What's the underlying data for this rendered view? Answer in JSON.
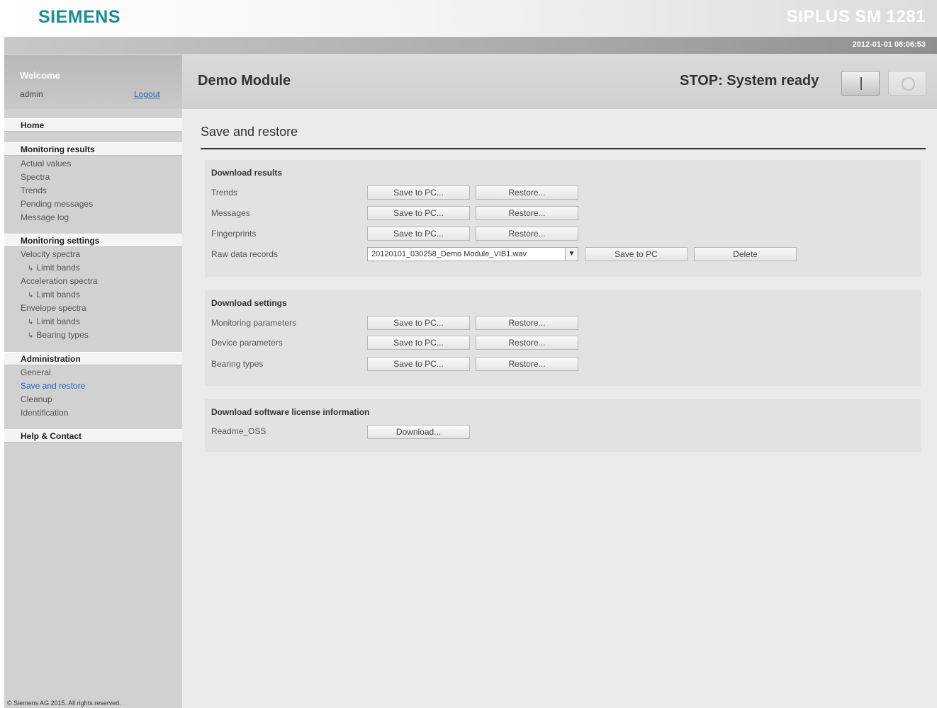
{
  "header": {
    "brand": "SIEMENS",
    "product": "SIPLUS SM 1281",
    "datetime": "2012-01-01 08:06:53"
  },
  "sidebar": {
    "welcome_title": "Welcome",
    "user": "admin",
    "logout": "Logout",
    "home": "Home",
    "monitoring_results": {
      "title": "Monitoring results",
      "items": [
        "Actual values",
        "Spectra",
        "Trends",
        "Pending messages",
        "Message log"
      ]
    },
    "monitoring_settings": {
      "title": "Monitoring settings",
      "items": [
        "Velocity spectra",
        "Limit bands",
        "Acceleration spectra",
        "Limit bands",
        "Envelope spectra",
        "Limit bands",
        "Bearing types"
      ]
    },
    "administration": {
      "title": "Administration",
      "items": [
        "General",
        "Save and restore",
        "Cleanup",
        "Identification"
      ]
    },
    "help": "Help & Contact",
    "copyright": "© Siemens AG 2015. All rights reserved."
  },
  "main": {
    "module_name": "Demo Module",
    "status": "STOP: System ready",
    "page_title": "Save and restore",
    "download_results": {
      "title": "Download results",
      "rows": [
        "Trends",
        "Messages",
        "Fingerprints",
        "Raw data records"
      ],
      "raw_file": "20120101_030258_Demo Module_VIB1.wav"
    },
    "download_settings": {
      "title": "Download settings",
      "rows": [
        "Monitoring parameters",
        "Device parameters",
        "Bearing types"
      ]
    },
    "download_license": {
      "title": "Download software license information",
      "rows": [
        "Readme_OSS"
      ]
    },
    "buttons": {
      "save_to_pc": "Save to PC...",
      "save_to_pc_plain": "Save to PC",
      "restore": "Restore...",
      "delete": "Delete",
      "download": "Download..."
    }
  },
  "colors": {
    "brand": "#1c8c98",
    "link": "#1e63c4",
    "sidebar_bg": "#d1d1d1",
    "main_bg": "#ebebeb"
  }
}
